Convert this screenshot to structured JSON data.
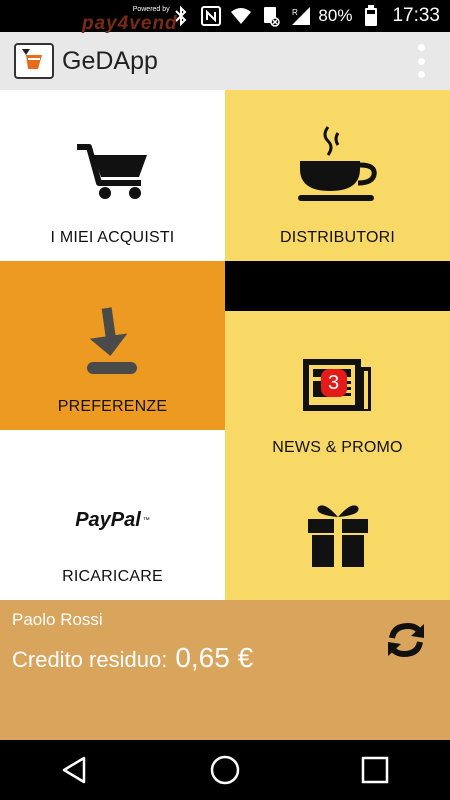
{
  "status_bar": {
    "battery": "80%",
    "time": "17:33",
    "icons": [
      "bluetooth-icon",
      "nfc-icon",
      "wifi-icon",
      "sim-icon",
      "signal-icon",
      "battery-icon"
    ]
  },
  "app_bar": {
    "title": "GeDApp",
    "logo": "gedapp-logo-icon",
    "menu": "overflow-menu-icon"
  },
  "tiles": {
    "acquisti": {
      "label": "I MIEI ACQUISTI",
      "icon": "shopping-cart-icon",
      "bg": "#ffffff"
    },
    "distributori": {
      "label": "DISTRIBUTORI",
      "icon": "coffee-cup-icon",
      "bg": "#f8d966"
    },
    "preferenze": {
      "label": "PREFERENZE",
      "icon": "download-icon",
      "bg": "#ed9a22"
    },
    "news": {
      "label": "NEWS & PROMO",
      "icon": "newspaper-icon",
      "badge": "3",
      "bg": "#f8d966"
    },
    "ricaricare": {
      "label": "RICARICARE",
      "brand": "PayPal",
      "bg": "#ffffff"
    },
    "gift": {
      "label": "",
      "icon": "gift-icon",
      "bg": "#f8d966"
    }
  },
  "banner": {
    "powered_by": "Powered by",
    "brand": "pay4vend"
  },
  "footer": {
    "user_name": "Paolo Rossi",
    "credit_label": "Credito residuo:",
    "credit_amount": "0,65 €",
    "refresh": "refresh-icon",
    "bg": "#d9a45c"
  },
  "nav_bar": {
    "buttons": [
      "back-icon",
      "home-icon",
      "recents-icon"
    ]
  },
  "colors": {
    "accent_orange": "#ed9a22",
    "yellow": "#f8d966",
    "tan": "#d9a45c",
    "badge_red": "#e31b1b"
  }
}
